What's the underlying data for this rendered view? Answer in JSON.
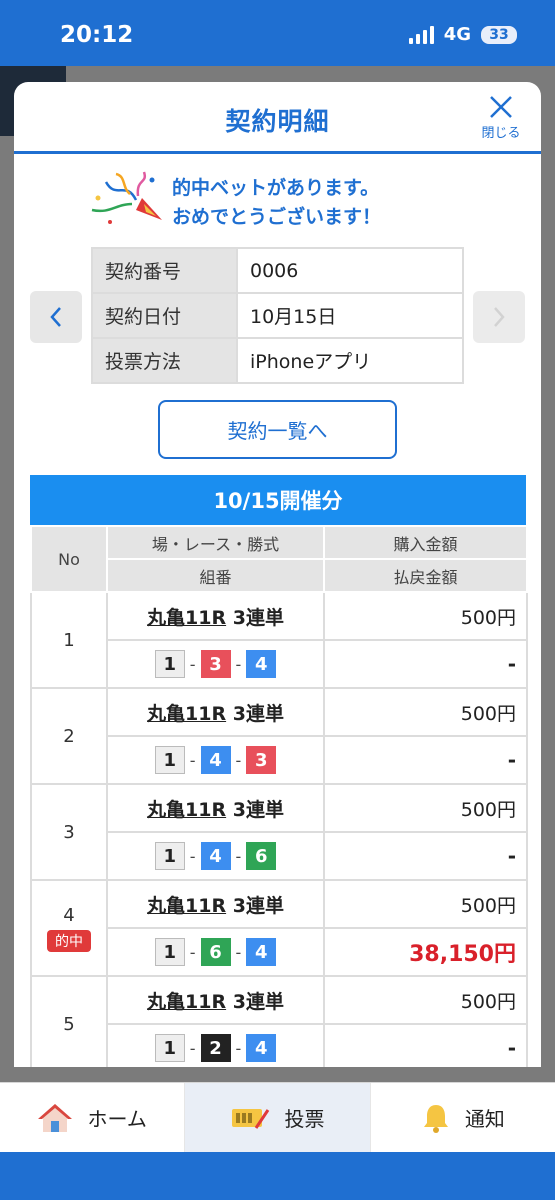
{
  "status_bar": {
    "time": "20:12",
    "network": "4G",
    "battery": "33"
  },
  "modal": {
    "title": "契約明細",
    "close_label": "閉じる",
    "banner_line1": "的中ベットがあります。",
    "banner_line2": "おめでとうございます！",
    "info": [
      {
        "label": "契約番号",
        "value": "0006"
      },
      {
        "label": "契約日付",
        "value": "10月15日"
      },
      {
        "label": "投票方法",
        "value": "iPhoneアプリ"
      }
    ],
    "list_button": "契約一覧へ",
    "section_title": "10/15開催分",
    "headers": {
      "no": "No",
      "race": "場・レース・勝式",
      "amount": "購入金額",
      "combo": "組番",
      "payout": "払戻金額"
    },
    "bets": [
      {
        "no": "1",
        "venue": "丸亀11R",
        "bet_type": "3連単",
        "amount": "500円",
        "payout": "-",
        "hit": false,
        "badge": "",
        "combo": [
          {
            "n": "1",
            "bg": "#eeeeee",
            "fg": "#222222"
          },
          {
            "n": "3",
            "bg": "#e8505b",
            "fg": "#ffffff"
          },
          {
            "n": "4",
            "bg": "#3d8ef0",
            "fg": "#ffffff"
          }
        ]
      },
      {
        "no": "2",
        "venue": "丸亀11R",
        "bet_type": "3連単",
        "amount": "500円",
        "payout": "-",
        "hit": false,
        "badge": "",
        "combo": [
          {
            "n": "1",
            "bg": "#eeeeee",
            "fg": "#222222"
          },
          {
            "n": "4",
            "bg": "#3d8ef0",
            "fg": "#ffffff"
          },
          {
            "n": "3",
            "bg": "#e8505b",
            "fg": "#ffffff"
          }
        ]
      },
      {
        "no": "3",
        "venue": "丸亀11R",
        "bet_type": "3連単",
        "amount": "500円",
        "payout": "-",
        "hit": false,
        "badge": "",
        "combo": [
          {
            "n": "1",
            "bg": "#eeeeee",
            "fg": "#222222"
          },
          {
            "n": "4",
            "bg": "#3d8ef0",
            "fg": "#ffffff"
          },
          {
            "n": "6",
            "bg": "#2fa556",
            "fg": "#ffffff"
          }
        ]
      },
      {
        "no": "4",
        "venue": "丸亀11R",
        "bet_type": "3連単",
        "amount": "500円",
        "payout": "38,150円",
        "hit": true,
        "badge": "的中",
        "combo": [
          {
            "n": "1",
            "bg": "#eeeeee",
            "fg": "#222222"
          },
          {
            "n": "6",
            "bg": "#2fa556",
            "fg": "#ffffff"
          },
          {
            "n": "4",
            "bg": "#3d8ef0",
            "fg": "#ffffff"
          }
        ]
      },
      {
        "no": "5",
        "venue": "丸亀11R",
        "bet_type": "3連単",
        "amount": "500円",
        "payout": "-",
        "hit": false,
        "badge": "",
        "combo": [
          {
            "n": "1",
            "bg": "#eeeeee",
            "fg": "#222222"
          },
          {
            "n": "2",
            "bg": "#222222",
            "fg": "#ffffff"
          },
          {
            "n": "4",
            "bg": "#3d8ef0",
            "fg": "#ffffff"
          }
        ]
      }
    ]
  },
  "tabbar": [
    {
      "label": "ホーム",
      "icon": "home-icon",
      "active": false
    },
    {
      "label": "投票",
      "icon": "ticket-icon",
      "active": true
    },
    {
      "label": "通知",
      "icon": "bell-icon",
      "active": false
    }
  ]
}
